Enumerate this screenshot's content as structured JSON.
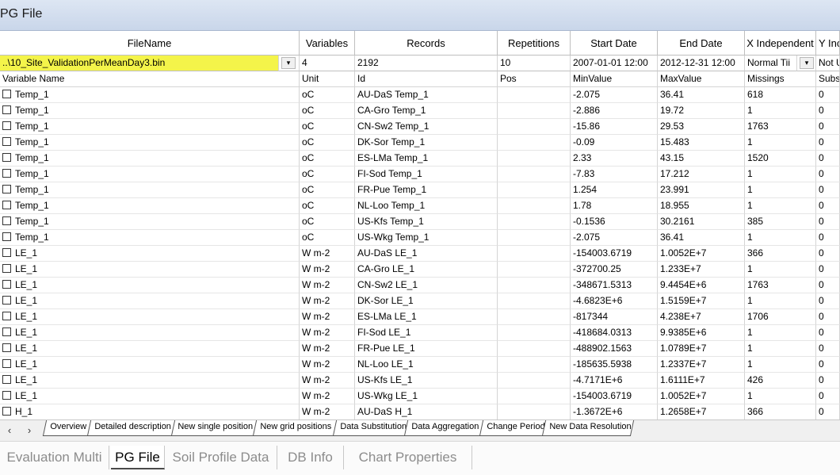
{
  "window": {
    "title": "PG File"
  },
  "header": {
    "filename": "FileName",
    "variables": "Variables",
    "records": "Records",
    "repetitions": "Repetitions",
    "start_date": "Start Date",
    "end_date": "End Date",
    "x_independent": "X Independent",
    "y_ind": "Y Inc"
  },
  "file_row": {
    "filename": "..\\10_Site_ValidationPerMeanDay3.bin",
    "variables": "4",
    "records": "2192",
    "repetitions": "10",
    "start_date": "2007-01-01 12:00",
    "end_date": "2012-12-31 12:00",
    "x_independent": "Normal Tii",
    "y_ind": "Not U"
  },
  "subheader": {
    "variable_name": "Variable Name",
    "unit": "Unit",
    "id": "Id",
    "pos": "Pos",
    "min": "MinValue",
    "max": "MaxValue",
    "missings": "Missings",
    "subs": "Subs"
  },
  "rows": [
    {
      "name": "Temp_1",
      "unit": "oC",
      "id": "AU-DaS Temp_1",
      "pos": "",
      "min": "-2.075",
      "max": "36.41",
      "missings": "618",
      "subs": "0"
    },
    {
      "name": "Temp_1",
      "unit": "oC",
      "id": "CA-Gro Temp_1",
      "pos": "",
      "min": "-2.886",
      "max": "19.72",
      "missings": "1",
      "subs": "0"
    },
    {
      "name": "Temp_1",
      "unit": "oC",
      "id": "CN-Sw2 Temp_1",
      "pos": "",
      "min": "-15.86",
      "max": "29.53",
      "missings": "1763",
      "subs": "0"
    },
    {
      "name": "Temp_1",
      "unit": "oC",
      "id": "DK-Sor Temp_1",
      "pos": "",
      "min": "-0.09",
      "max": "15.483",
      "missings": "1",
      "subs": "0"
    },
    {
      "name": "Temp_1",
      "unit": "oC",
      "id": "ES-LMa Temp_1",
      "pos": "",
      "min": "2.33",
      "max": "43.15",
      "missings": "1520",
      "subs": "0"
    },
    {
      "name": "Temp_1",
      "unit": "oC",
      "id": "FI-Sod Temp_1",
      "pos": "",
      "min": "-7.83",
      "max": "17.212",
      "missings": "1",
      "subs": "0"
    },
    {
      "name": "Temp_1",
      "unit": "oC",
      "id": "FR-Pue Temp_1",
      "pos": "",
      "min": "1.254",
      "max": "23.991",
      "missings": "1",
      "subs": "0"
    },
    {
      "name": "Temp_1",
      "unit": "oC",
      "id": "NL-Loo Temp_1",
      "pos": "",
      "min": "1.78",
      "max": "18.955",
      "missings": "1",
      "subs": "0"
    },
    {
      "name": "Temp_1",
      "unit": "oC",
      "id": "US-Kfs Temp_1",
      "pos": "",
      "min": "-0.1536",
      "max": "30.2161",
      "missings": "385",
      "subs": "0"
    },
    {
      "name": "Temp_1",
      "unit": "oC",
      "id": "US-Wkg Temp_1",
      "pos": "",
      "min": "-2.075",
      "max": "36.41",
      "missings": "1",
      "subs": "0"
    },
    {
      "name": "LE_1",
      "unit": "W m-2",
      "id": "AU-DaS LE_1",
      "pos": "",
      "min": "-154003.6719",
      "max": "1.0052E+7",
      "missings": "366",
      "subs": "0"
    },
    {
      "name": "LE_1",
      "unit": "W m-2",
      "id": "CA-Gro LE_1",
      "pos": "",
      "min": "-372700.25",
      "max": "1.233E+7",
      "missings": "1",
      "subs": "0"
    },
    {
      "name": "LE_1",
      "unit": "W m-2",
      "id": "CN-Sw2 LE_1",
      "pos": "",
      "min": "-348671.5313",
      "max": "9.4454E+6",
      "missings": "1763",
      "subs": "0"
    },
    {
      "name": "LE_1",
      "unit": "W m-2",
      "id": "DK-Sor LE_1",
      "pos": "",
      "min": "-4.6823E+6",
      "max": "1.5159E+7",
      "missings": "1",
      "subs": "0"
    },
    {
      "name": "LE_1",
      "unit": "W m-2",
      "id": "ES-LMa LE_1",
      "pos": "",
      "min": "-817344",
      "max": "4.238E+7",
      "missings": "1706",
      "subs": "0"
    },
    {
      "name": "LE_1",
      "unit": "W m-2",
      "id": "FI-Sod LE_1",
      "pos": "",
      "min": "-418684.0313",
      "max": "9.9385E+6",
      "missings": "1",
      "subs": "0"
    },
    {
      "name": "LE_1",
      "unit": "W m-2",
      "id": "FR-Pue LE_1",
      "pos": "",
      "min": "-488902.1563",
      "max": "1.0789E+7",
      "missings": "1",
      "subs": "0"
    },
    {
      "name": "LE_1",
      "unit": "W m-2",
      "id": "NL-Loo LE_1",
      "pos": "",
      "min": "-185635.5938",
      "max": "1.2337E+7",
      "missings": "1",
      "subs": "0"
    },
    {
      "name": "LE_1",
      "unit": "W m-2",
      "id": "US-Kfs LE_1",
      "pos": "",
      "min": "-4.7171E+6",
      "max": "1.6111E+7",
      "missings": "426",
      "subs": "0"
    },
    {
      "name": "LE_1",
      "unit": "W m-2",
      "id": "US-Wkg LE_1",
      "pos": "",
      "min": "-154003.6719",
      "max": "1.0052E+7",
      "missings": "1",
      "subs": "0"
    },
    {
      "name": "H_1",
      "unit": "W m-2",
      "id": "AU-DaS H_1",
      "pos": "",
      "min": "-1.3672E+6",
      "max": "1.2658E+7",
      "missings": "366",
      "subs": "0"
    }
  ],
  "worksheet_tabs": [
    "Overview",
    "Detailed description",
    "New single position",
    "New grid positions",
    "Data Substitution",
    "Data Aggregation",
    "Change Period",
    "New Data Resolution"
  ],
  "active_worksheet_tab": "Detailed description",
  "bottom_tabs": [
    "Evaluation Multi",
    "PG File",
    "Soil Profile Data",
    "DB Info",
    "Chart Properties"
  ],
  "active_bottom_tab": "PG File",
  "icons": {
    "nav_prev": "chevron-left-icon",
    "nav_next": "chevron-right-icon",
    "dropdown": "dropdown-arrow-icon"
  },
  "colors": {
    "filename_highlight": "#f4f44a",
    "title_gradient_top": "#dde6f3"
  }
}
